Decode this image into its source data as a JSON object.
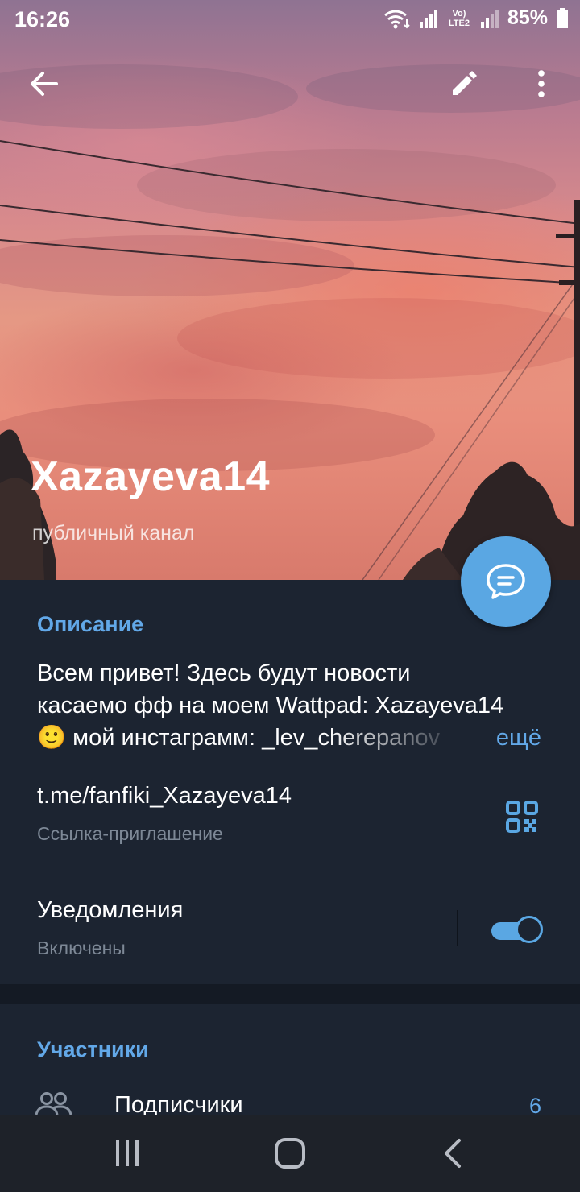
{
  "status_bar": {
    "time": "16:26",
    "battery": "85%",
    "network_label": "Vo) LTE2"
  },
  "toolbar": {
    "back_icon": "arrow-left-icon",
    "edit_icon": "pencil-icon",
    "menu_icon": "more-vertical-icon"
  },
  "channel": {
    "name": "Xazayeva14",
    "type": "публичный канал"
  },
  "description": {
    "title": "Описание",
    "line1": "Всем привет! Здесь будут новости",
    "line2": "касаемо фф на моем Wattpad: Xazayeva14",
    "emoji": "🙂",
    "line3": " мой инстаграмм: _lev_cherepanov",
    "more": "ещё"
  },
  "invite_link": {
    "url": "t.me/fanfiki_Xazayeva14",
    "label": "Ссылка-приглашение",
    "icon": "qr-code-icon"
  },
  "notifications": {
    "title": "Уведомления",
    "status": "Включены",
    "enabled": true
  },
  "members": {
    "title": "Участники",
    "subscribers_label": "Подписчики",
    "subscribers_count": "6"
  },
  "colors": {
    "accent": "#5aa7e3",
    "background": "#1c2431",
    "link_text": "#62a8e8"
  }
}
